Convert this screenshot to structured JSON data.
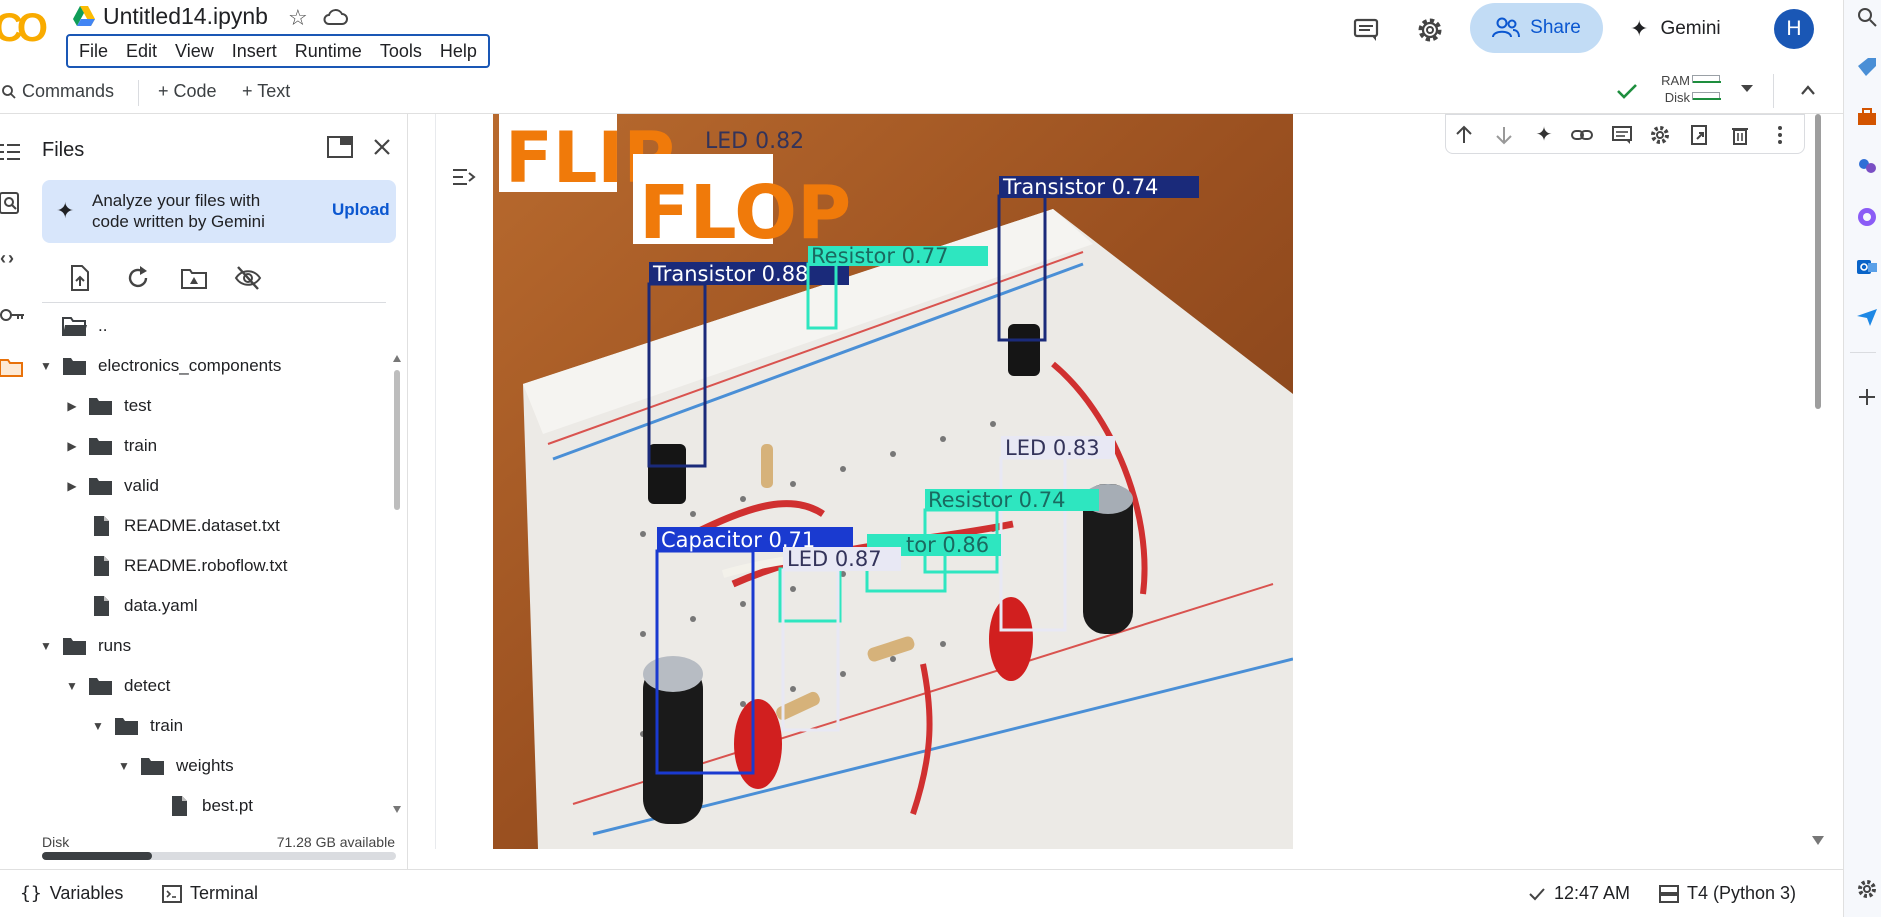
{
  "app": {
    "logo": "CO",
    "title": "Untitled14.ipynb"
  },
  "menu": [
    "File",
    "Edit",
    "View",
    "Insert",
    "Runtime",
    "Tools",
    "Help"
  ],
  "header": {
    "share_label": "Share",
    "gemini_label": "Gemini",
    "avatar_initial": "H"
  },
  "toolbar": {
    "commands_label": "Commands",
    "code_label": "+ Code",
    "text_label": "+ Text",
    "ram_label": "RAM",
    "disk_label": "Disk"
  },
  "files": {
    "title": "Files",
    "gemini_prompt": "Analyze your files with code written by Gemini",
    "gemini_prompt_line1": "Analyze your files with",
    "gemini_prompt_line2": "code written by Gemini",
    "upload_label": "Upload",
    "tree": [
      {
        "name": "..",
        "type": "folder-open",
        "depth": 0,
        "expanded": null
      },
      {
        "name": "electronics_components",
        "type": "folder",
        "depth": 0,
        "expanded": true
      },
      {
        "name": "test",
        "type": "folder",
        "depth": 1,
        "expanded": false
      },
      {
        "name": "train",
        "type": "folder",
        "depth": 1,
        "expanded": false
      },
      {
        "name": "valid",
        "type": "folder",
        "depth": 1,
        "expanded": false
      },
      {
        "name": "README.dataset.txt",
        "type": "file",
        "depth": 1,
        "expanded": null
      },
      {
        "name": "README.roboflow.txt",
        "type": "file",
        "depth": 1,
        "expanded": null
      },
      {
        "name": "data.yaml",
        "type": "file",
        "depth": 1,
        "expanded": null
      },
      {
        "name": "runs",
        "type": "folder",
        "depth": 0,
        "expanded": true
      },
      {
        "name": "detect",
        "type": "folder",
        "depth": 1,
        "expanded": true
      },
      {
        "name": "train",
        "type": "folder",
        "depth": 2,
        "expanded": true
      },
      {
        "name": "weights",
        "type": "folder",
        "depth": 3,
        "expanded": true
      },
      {
        "name": "best.pt",
        "type": "file",
        "depth": 4,
        "expanded": null
      }
    ],
    "disk_label": "Disk",
    "disk_available": "71.28 GB available",
    "disk_used_fraction": 0.31
  },
  "output_image": {
    "sign_text_1": "FLIP",
    "sign_text_2": "FLOP",
    "detections": [
      {
        "label": "LED 0.82",
        "color": "#e8e8f4"
      },
      {
        "label": "Transistor 0.74",
        "color": "#1a2a7a"
      },
      {
        "label": "Transistor 0.88",
        "color": "#1a2a7a"
      },
      {
        "label": "Resistor 0.77",
        "color": "#2ee6c0"
      },
      {
        "label": "LED 0.83",
        "color": "#e8e8f4"
      },
      {
        "label": "Resistor 0.74",
        "color": "#2ee6c0"
      },
      {
        "label": "Capacitor 0.71",
        "color": "#1a3ad0"
      },
      {
        "label": "LED 0.87",
        "color": "#e8e8f4"
      },
      {
        "label": "tor 0.86",
        "color": "#2ee6c0"
      }
    ]
  },
  "status": {
    "variables_label": "Variables",
    "terminal_label": "Terminal",
    "time": "12:47 AM",
    "runtime": "T4 (Python 3)"
  },
  "colors": {
    "accent": "#0b57d0",
    "share_bg": "#c2dcf5",
    "gemini_card_bg": "#d8e6fb",
    "avatar_bg": "#1a57b5"
  }
}
